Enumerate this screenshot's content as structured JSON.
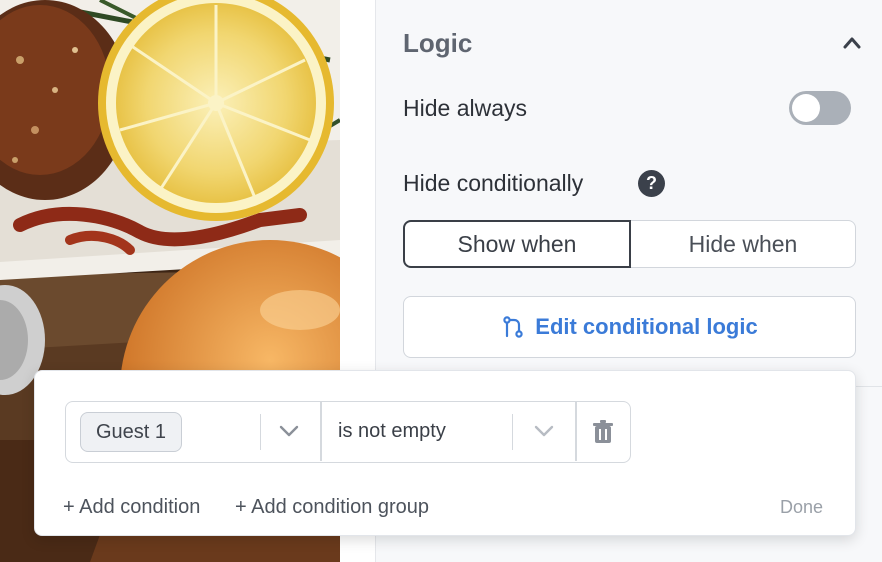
{
  "logic": {
    "title": "Logic",
    "hide_always": {
      "label": "Hide always",
      "enabled": false
    },
    "hide_conditionally": {
      "label": "Hide conditionally"
    },
    "mode_options": [
      "Show when",
      "Hide when"
    ],
    "selected_mode": "Show when",
    "edit_button": "Edit conditional logic"
  },
  "condition_popover": {
    "conditions": [
      {
        "field": "Guest 1",
        "operator": "is not empty"
      }
    ],
    "add_condition": "+ Add condition",
    "add_condition_group": "+ Add condition group",
    "done": "Done"
  },
  "colors": {
    "accent": "#3b7bd8",
    "toggle_off": "#aab0b8",
    "panel_bg": "#f7f8fa"
  },
  "icons": [
    "chevron-up-icon",
    "help-icon",
    "branch-icon",
    "chevron-down-icon",
    "trash-icon"
  ]
}
